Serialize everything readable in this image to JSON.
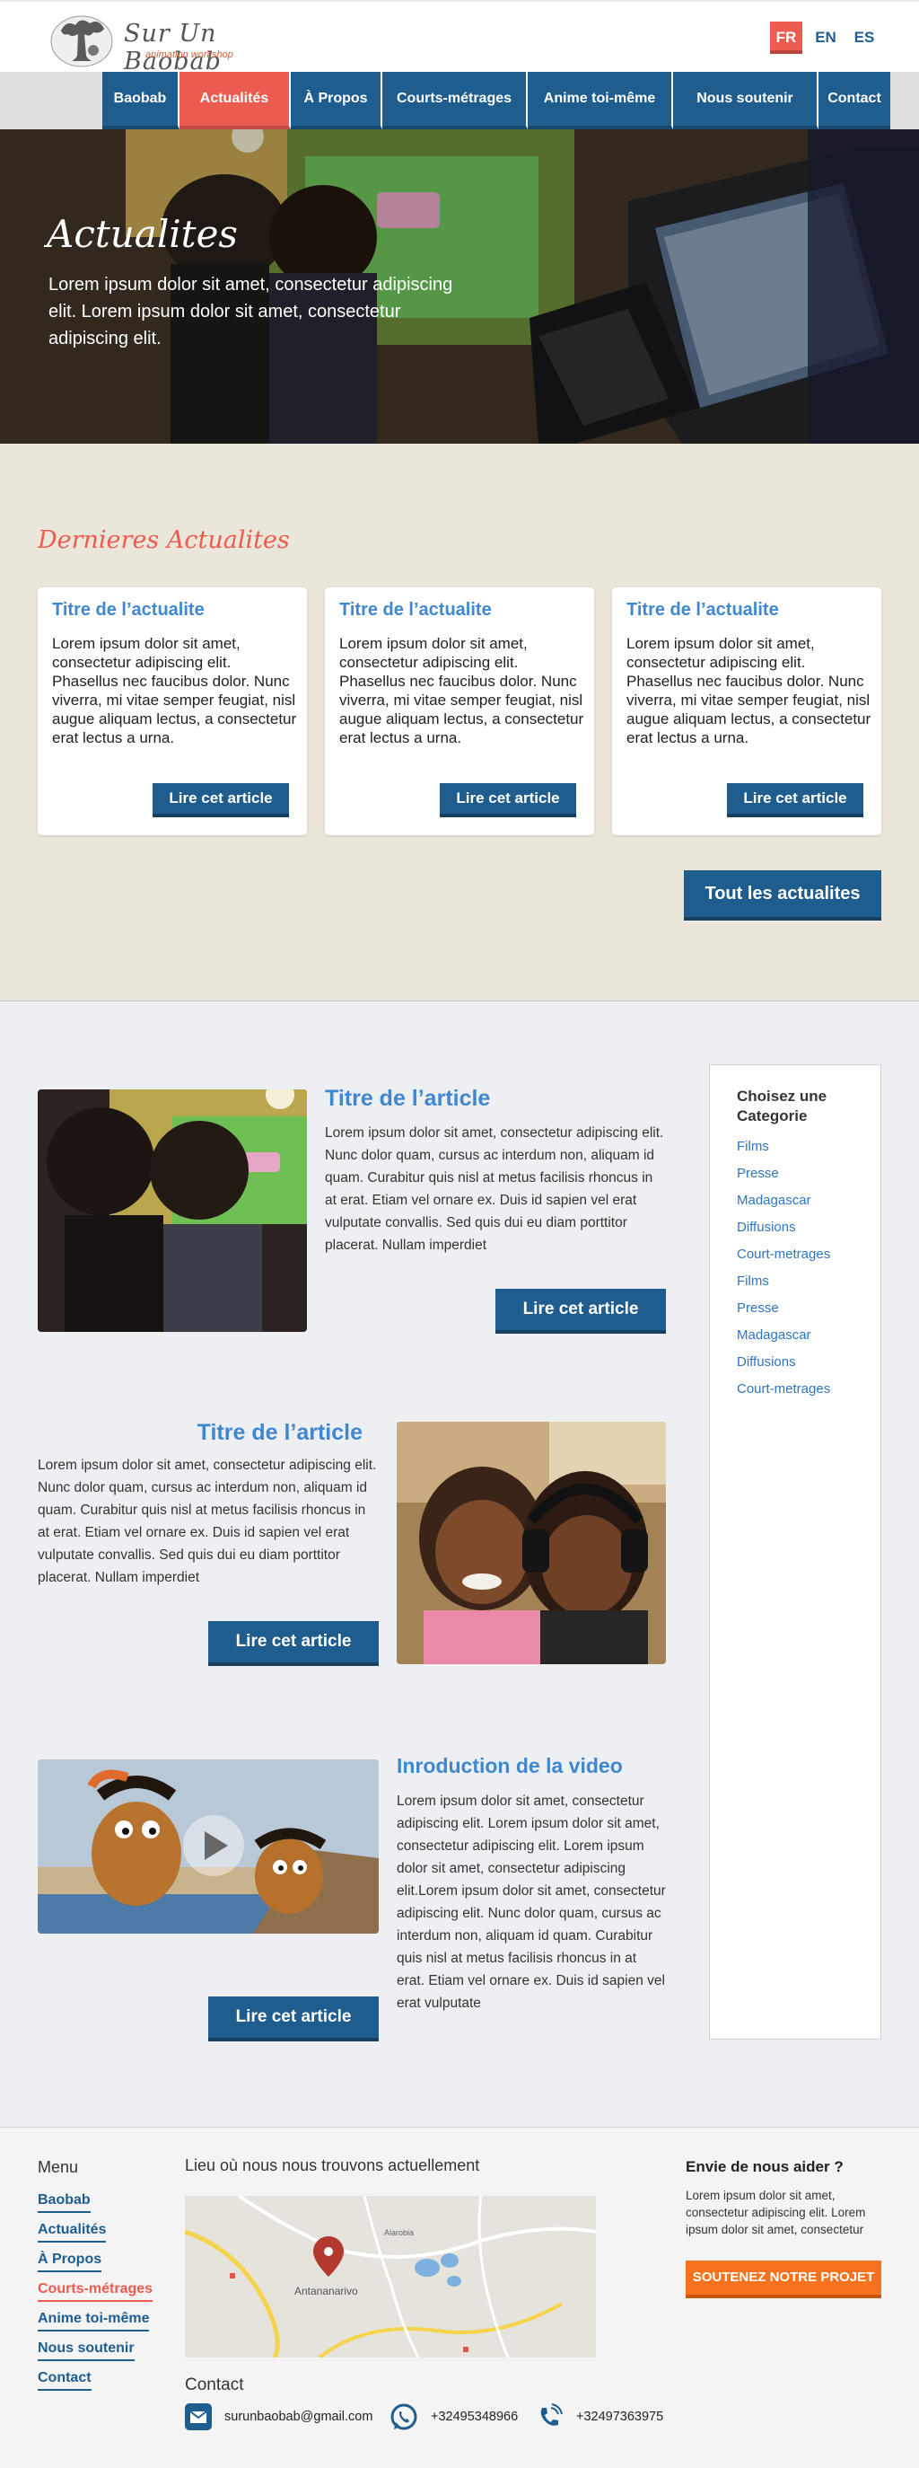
{
  "header": {
    "logo_title": "Sur Un Baobab",
    "logo_subtitle": "animation workshop",
    "languages": [
      "FR",
      "EN",
      "ES"
    ],
    "active_language": "FR"
  },
  "nav": {
    "items": [
      "Baobab",
      "Actualités",
      "À Propos",
      "Courts-métrages",
      "Anime toi-même",
      "Nous soutenir",
      "Contact"
    ],
    "active": "Actualités"
  },
  "hero": {
    "title": "Actualites",
    "text": "Lorem ipsum dolor sit amet, consectetur adipiscing elit. Lorem ipsum dolor sit amet, consectetur adipiscing elit."
  },
  "latest": {
    "heading": "Dernieres Actualites",
    "cards": [
      {
        "title": "Titre de l’actualite",
        "text": "Lorem ipsum dolor sit amet, consectetur adipiscing elit. Phasellus nec faucibus dolor. Nunc viverra, mi vitae semper feugiat, nisl augue aliquam lectus, a consectetur erat lectus a urna.",
        "button": "Lire cet article"
      },
      {
        "title": "Titre de l’actualite",
        "text": "Lorem ipsum dolor sit amet, consectetur adipiscing elit. Phasellus nec faucibus dolor. Nunc viverra, mi vitae semper feugiat, nisl augue aliquam lectus, a consectetur erat lectus a urna.",
        "button": "Lire cet article"
      },
      {
        "title": "Titre de l’actualite",
        "text": "Lorem ipsum dolor sit amet, consectetur adipiscing elit. Phasellus nec faucibus dolor. Nunc viverra, mi vitae semper feugiat, nisl augue aliquam lectus, a consectetur erat lectus a urna.",
        "button": "Lire cet article"
      }
    ],
    "all_button": "Tout les actualites"
  },
  "articles": [
    {
      "title": "Titre de l’article",
      "text": "Lorem ipsum dolor sit amet, consectetur adipiscing elit. Nunc dolor quam, cursus ac interdum non, aliquam id quam. Curabitur quis nisl at metus facilisis rhoncus in at erat. Etiam vel ornare ex. Duis id sapien vel erat vulputate convallis. Sed quis dui eu diam porttitor placerat. Nullam imperdiet",
      "button": "Lire cet article"
    },
    {
      "title": "Titre de l’article",
      "text": "Lorem ipsum dolor sit amet, consectetur adipiscing elit. Nunc dolor quam, cursus ac interdum non, aliquam id quam. Curabitur quis nisl at metus facilisis rhoncus in at erat. Etiam vel ornare ex. Duis id sapien vel erat vulputate convallis. Sed quis dui eu diam porttitor placerat. Nullam imperdiet",
      "button": "Lire cet article"
    },
    {
      "title": "Inroduction de la video",
      "text": "Lorem ipsum dolor sit amet, consectetur adipiscing elit. Lorem ipsum dolor sit amet, consectetur adipiscing elit. Lorem ipsum dolor sit amet, consectetur adipiscing elit.Lorem ipsum dolor sit amet, consectetur adipiscing elit. Nunc dolor quam, cursus ac interdum non, aliquam id quam. Curabitur quis nisl at metus facilisis rhoncus in at erat. Etiam vel ornare ex. Duis id sapien vel erat vulputate",
      "button": "Lire cet article"
    }
  ],
  "categories": {
    "title": "Choisez une Categorie",
    "items": [
      "Films",
      "Presse",
      "Madagascar",
      "Diffusions",
      "Court-metrages",
      "Films",
      "Presse",
      "Madagascar",
      "Diffusions",
      "Court-metrages"
    ]
  },
  "footer": {
    "menu_title": "Menu",
    "menu": [
      "Baobab",
      "Actualités",
      "À Propos",
      "Courts-métrages",
      "Anime toi-même",
      "Nous soutenir",
      "Contact"
    ],
    "menu_active": "Courts-métrages",
    "location_title": "Lieu où nous nous trouvons actuellement",
    "map_city": "Antananarivo",
    "map_place": "Alarobia",
    "contact_title": "Contact",
    "email": "surunbaobab@gmail.com",
    "whatsapp": "+32495348966",
    "phone": "+32497363975",
    "help_title": "Envie de nous aider ?",
    "help_text": "Lorem ipsum dolor sit amet, consectetur adipiscing elit. Lorem ipsum dolor sit amet, consectetur",
    "help_button": "SOUTENEZ NOTRE PROJET"
  },
  "colors": {
    "primary": "#1f5d8f",
    "accent": "#ec5b4f",
    "link": "#3f87cf",
    "cta": "#f7721d",
    "news_bg": "#ebe6da"
  }
}
